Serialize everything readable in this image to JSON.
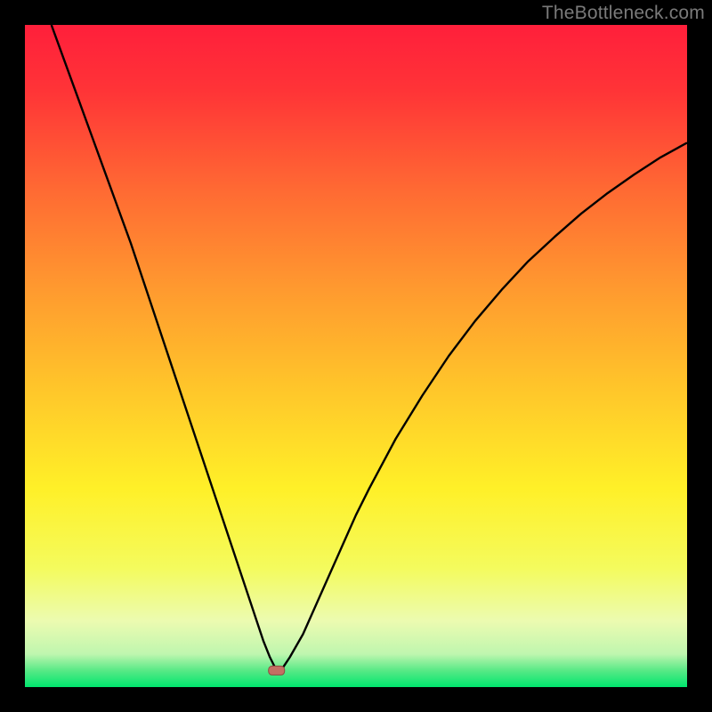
{
  "watermark": "TheBottleneck.com",
  "colors": {
    "gradient_stops": [
      {
        "offset": 0.0,
        "color": "#ff1f3b"
      },
      {
        "offset": 0.1,
        "color": "#ff3437"
      },
      {
        "offset": 0.25,
        "color": "#ff6a33"
      },
      {
        "offset": 0.4,
        "color": "#ff9a2f"
      },
      {
        "offset": 0.55,
        "color": "#ffc62a"
      },
      {
        "offset": 0.7,
        "color": "#fff028"
      },
      {
        "offset": 0.82,
        "color": "#f4fb5d"
      },
      {
        "offset": 0.9,
        "color": "#ecfbb0"
      },
      {
        "offset": 0.95,
        "color": "#bff6af"
      },
      {
        "offset": 0.975,
        "color": "#58e986"
      },
      {
        "offset": 1.0,
        "color": "#00e66e"
      }
    ],
    "curve": "#000000",
    "marker_fill": "#c47063",
    "marker_stroke": "#8f4a40",
    "frame": "#000000"
  },
  "chart_data": {
    "type": "line",
    "title": "",
    "xlabel": "",
    "ylabel": "",
    "xlim": [
      0,
      100
    ],
    "ylim": [
      0,
      100
    ],
    "marker": {
      "x": 38,
      "y": 2.5
    },
    "series": [
      {
        "name": "curve",
        "x": [
          4,
          6,
          8,
          10,
          12,
          14,
          16,
          18,
          20,
          22,
          24,
          26,
          28,
          30,
          32,
          34,
          35,
          36,
          37,
          38,
          39,
          40,
          42,
          44,
          46,
          48,
          50,
          52,
          56,
          60,
          64,
          68,
          72,
          76,
          80,
          84,
          88,
          92,
          96,
          100
        ],
        "y": [
          100,
          94.5,
          89,
          83.5,
          78,
          72.5,
          67,
          61,
          55,
          49,
          43,
          37,
          31,
          25,
          19,
          13,
          10,
          7,
          4.5,
          2.5,
          3,
          4.5,
          8,
          12.5,
          17,
          21.5,
          26,
          30,
          37.5,
          44,
          50,
          55.3,
          60,
          64.3,
          68,
          71.5,
          74.6,
          77.4,
          80,
          82.2
        ]
      }
    ]
  }
}
